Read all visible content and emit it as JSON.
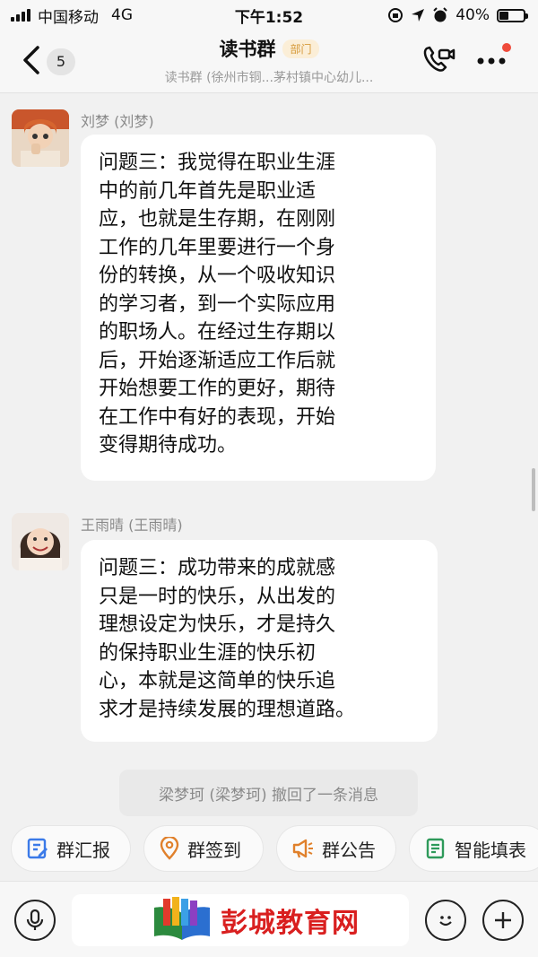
{
  "status_bar": {
    "carrier": "中国移动",
    "network": "4G",
    "time": "下午1:52",
    "battery": "40%",
    "battery_level": 0.4
  },
  "header": {
    "back_count": "5",
    "title": "读书群",
    "badge": "部门",
    "subtitle": "读书群 (徐州市铜...茅村镇中心幼儿..."
  },
  "messages": [
    {
      "sender": "刘梦 (刘梦)",
      "lines": [
        "问题三：我觉得在职业生涯",
        "中的前几年首先是职业适",
        "应，也就是生存期，在刚刚",
        "工作的几年里要进行一个身",
        "份的转换，从一个吸收知识",
        "的学习者，到一个实际应用",
        "的职场人。在经过生存期以",
        "后，开始逐渐适应工作后就",
        "开始想要工作的更好，期待",
        "在工作中有好的表现，开始",
        "变得期待成功。"
      ]
    },
    {
      "sender": "王雨晴 (王雨晴)",
      "lines": [
        "问题三：成功带来的成就感",
        "只是一时的快乐，从出发的",
        "理想设定为快乐，才是持久",
        "的保持职业生涯的快乐初",
        "心，本就是这简单的快乐追",
        "求才是持续发展的理想道路。"
      ]
    }
  ],
  "system_message": "梁梦珂 (梁梦珂) 撤回了一条消息",
  "quick_actions": [
    {
      "label": "群汇报",
      "icon": "report-icon"
    },
    {
      "label": "群签到",
      "icon": "location-icon"
    },
    {
      "label": "群公告",
      "icon": "megaphone-icon"
    },
    {
      "label": "智能填表",
      "icon": "form-icon"
    }
  ],
  "watermark": {
    "text": "彭城教育网"
  },
  "colors": {
    "accent": "#3b7ae8",
    "badge_text": "#d69a3a",
    "watermark_red": "#d91f1f",
    "notification_dot": "#ef4b3b"
  }
}
